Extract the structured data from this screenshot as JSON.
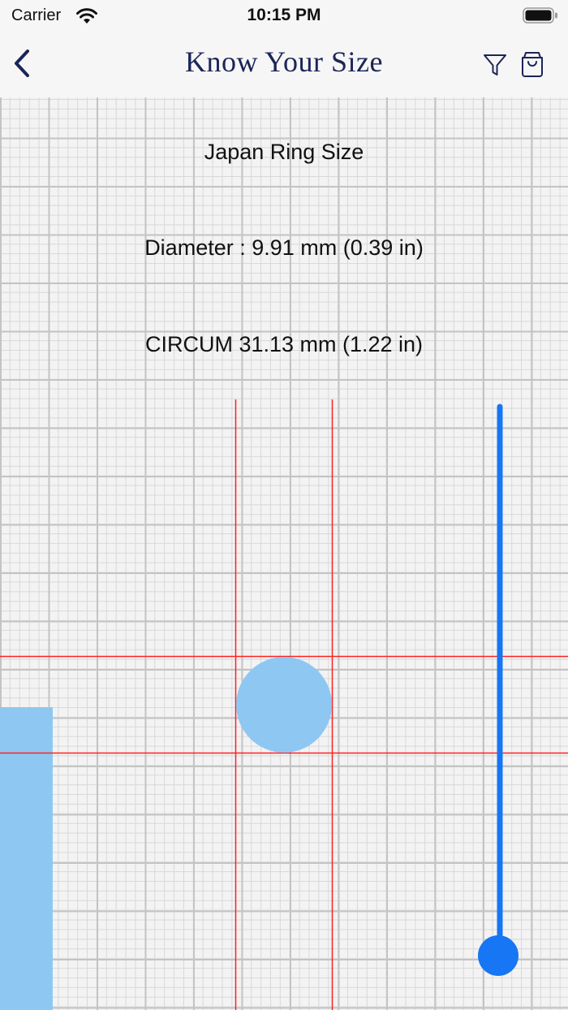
{
  "status_bar": {
    "carrier": "Carrier",
    "time": "10:15 PM"
  },
  "nav": {
    "title": "Know Your Size",
    "back_icon": "chevron-left-icon",
    "filter_icon": "filter-icon",
    "bag_icon": "shopping-bag-icon"
  },
  "ring_info": {
    "size_system": "Japan Ring Size",
    "diameter_text": "Diameter :  9.91 mm (0.39 in)",
    "circum_text": "CIRCUM  31.13 mm (1.22 in)"
  },
  "colors": {
    "nav_title": "#1b2557",
    "guide_lines": "#ff2020",
    "ring_fill": "#8ec8f2",
    "slider": "#1676f3"
  },
  "slider": {
    "value": 0.0
  }
}
